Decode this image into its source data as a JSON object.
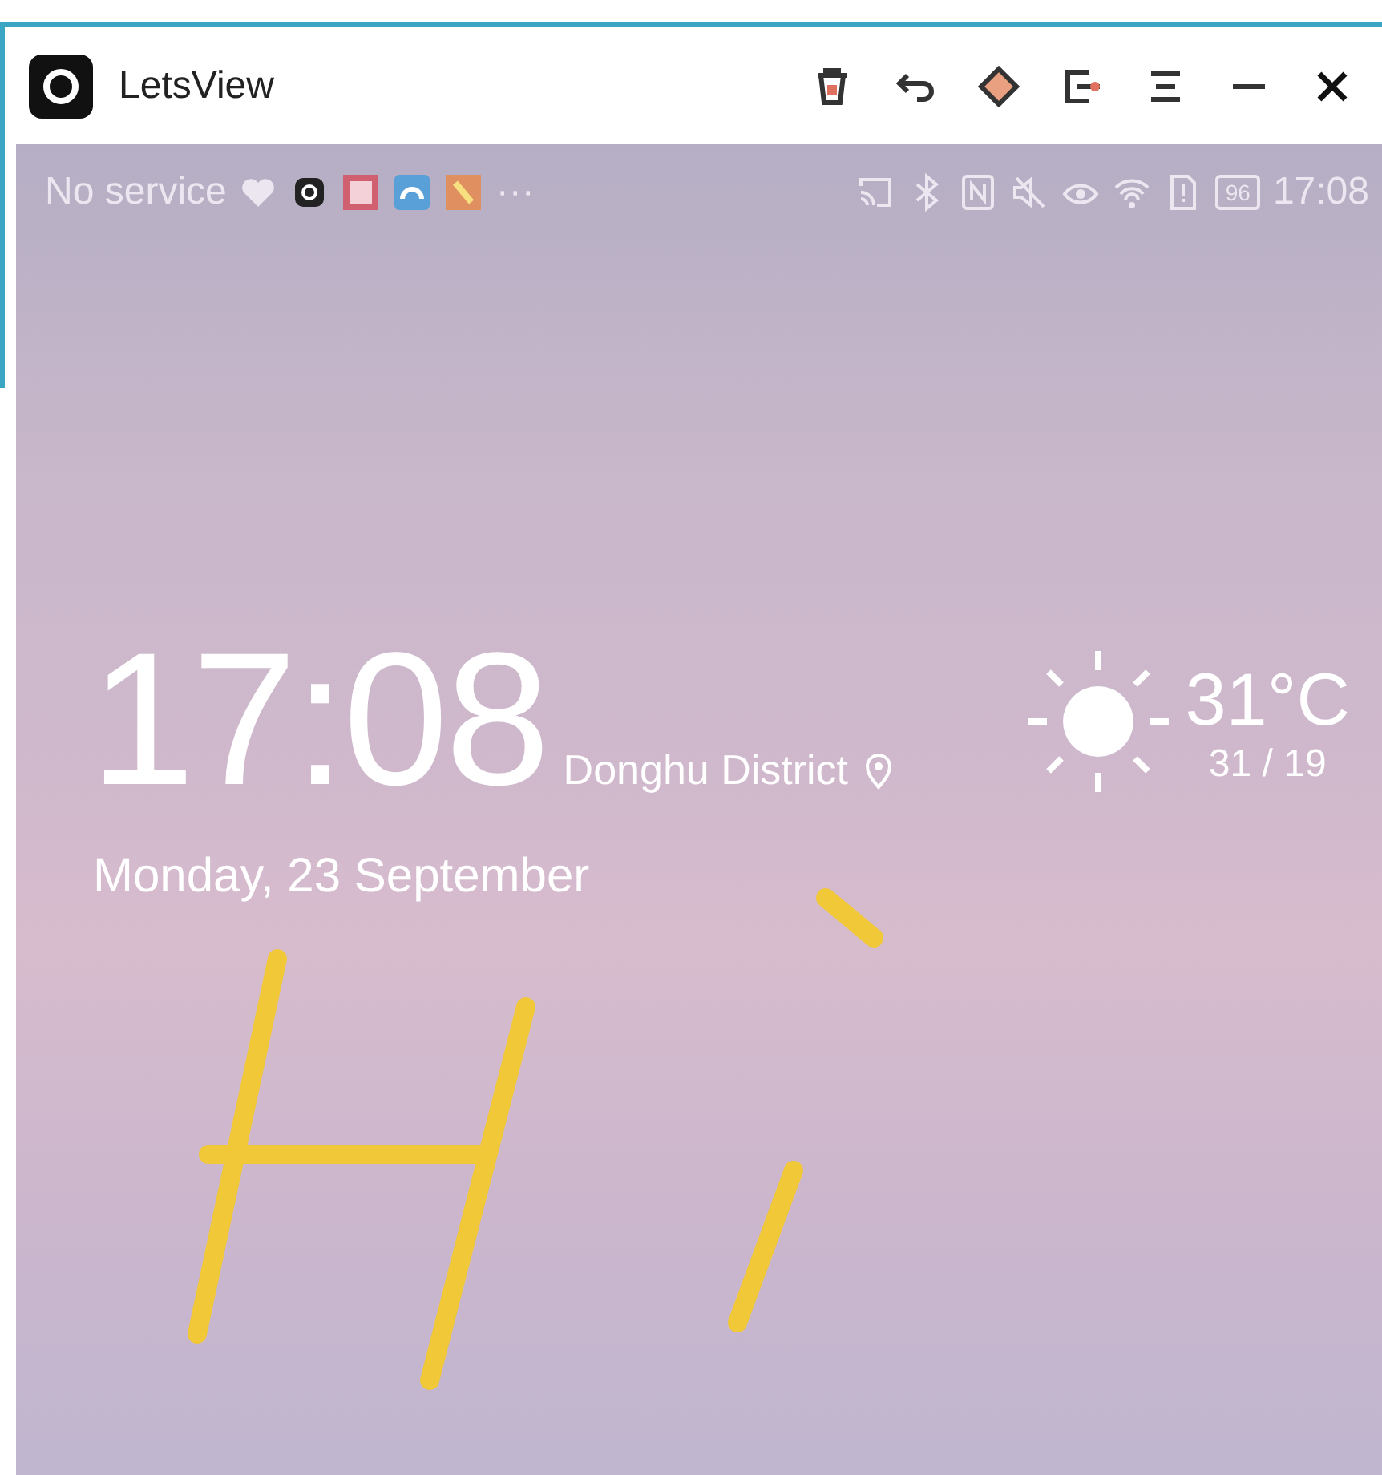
{
  "window": {
    "title": "LetsView"
  },
  "status_bar": {
    "carrier": "No service",
    "more": "···",
    "battery": "96",
    "time": "17:08"
  },
  "lock_screen": {
    "time": "17:08",
    "location": "Donghu District",
    "date": "Monday, 23 September",
    "temperature": "31°C",
    "range": "31 / 19"
  }
}
